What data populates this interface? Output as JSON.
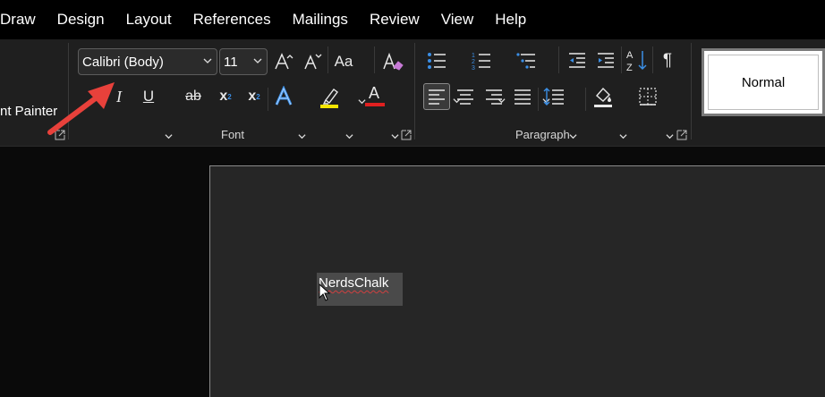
{
  "menu": {
    "items": [
      {
        "label": "Draw"
      },
      {
        "label": "Design"
      },
      {
        "label": "Layout"
      },
      {
        "label": "References"
      },
      {
        "label": "Mailings"
      },
      {
        "label": "Review"
      },
      {
        "label": "View"
      },
      {
        "label": "Help"
      }
    ]
  },
  "clipboard": {
    "format_painter_label": "nt Painter"
  },
  "font": {
    "group_label": "Font",
    "font_name": "Calibri (Body)",
    "font_size": "11",
    "change_case_label": "Aa",
    "italic_label": "I",
    "underline_label": "U",
    "strike_label": "ab",
    "subscript_label": "x",
    "superscript_label": "x",
    "font_color_label": "A",
    "highlight_color": "#f5e500",
    "font_color": "#e02020"
  },
  "paragraph": {
    "group_label": "Paragraph"
  },
  "styles": {
    "normal_label": "Normal"
  },
  "document": {
    "text": "NerdsChalk"
  },
  "colors": {
    "accent_arrow": "#e8413b",
    "text_effects": "#3b8fe6"
  }
}
